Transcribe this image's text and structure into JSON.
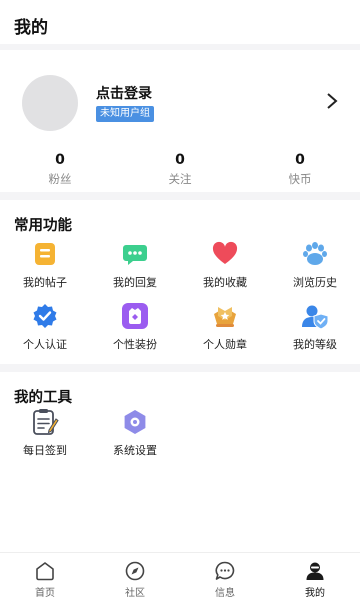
{
  "header": {
    "title": "我的"
  },
  "profile": {
    "login_text": "点击登录",
    "group_badge": "未知用户组",
    "stats": [
      {
        "value": "0",
        "label": "粉丝"
      },
      {
        "value": "0",
        "label": "关注"
      },
      {
        "value": "0",
        "label": "快币"
      }
    ]
  },
  "common": {
    "title": "常用功能",
    "items": [
      {
        "label": "我的帖子",
        "icon": "post-icon"
      },
      {
        "label": "我的回复",
        "icon": "reply-icon"
      },
      {
        "label": "我的收藏",
        "icon": "heart-icon"
      },
      {
        "label": "浏览历史",
        "icon": "paw-icon"
      },
      {
        "label": "个人认证",
        "icon": "verified-icon"
      },
      {
        "label": "个性装扮",
        "icon": "dressup-icon"
      },
      {
        "label": "个人勋章",
        "icon": "medal-icon"
      },
      {
        "label": "我的等级",
        "icon": "level-icon"
      }
    ]
  },
  "tools": {
    "title": "我的工具",
    "items": [
      {
        "label": "每日签到",
        "icon": "checkin-icon"
      },
      {
        "label": "系统设置",
        "icon": "settings-icon"
      }
    ]
  },
  "nav": {
    "items": [
      {
        "label": "首页",
        "icon": "home-icon"
      },
      {
        "label": "社区",
        "icon": "compass-icon"
      },
      {
        "label": "信息",
        "icon": "message-icon"
      },
      {
        "label": "我的",
        "icon": "profile-icon"
      }
    ]
  },
  "colors": {
    "badge_blue": "#4a90e2",
    "avatar_gray": "#e1e1e3"
  }
}
